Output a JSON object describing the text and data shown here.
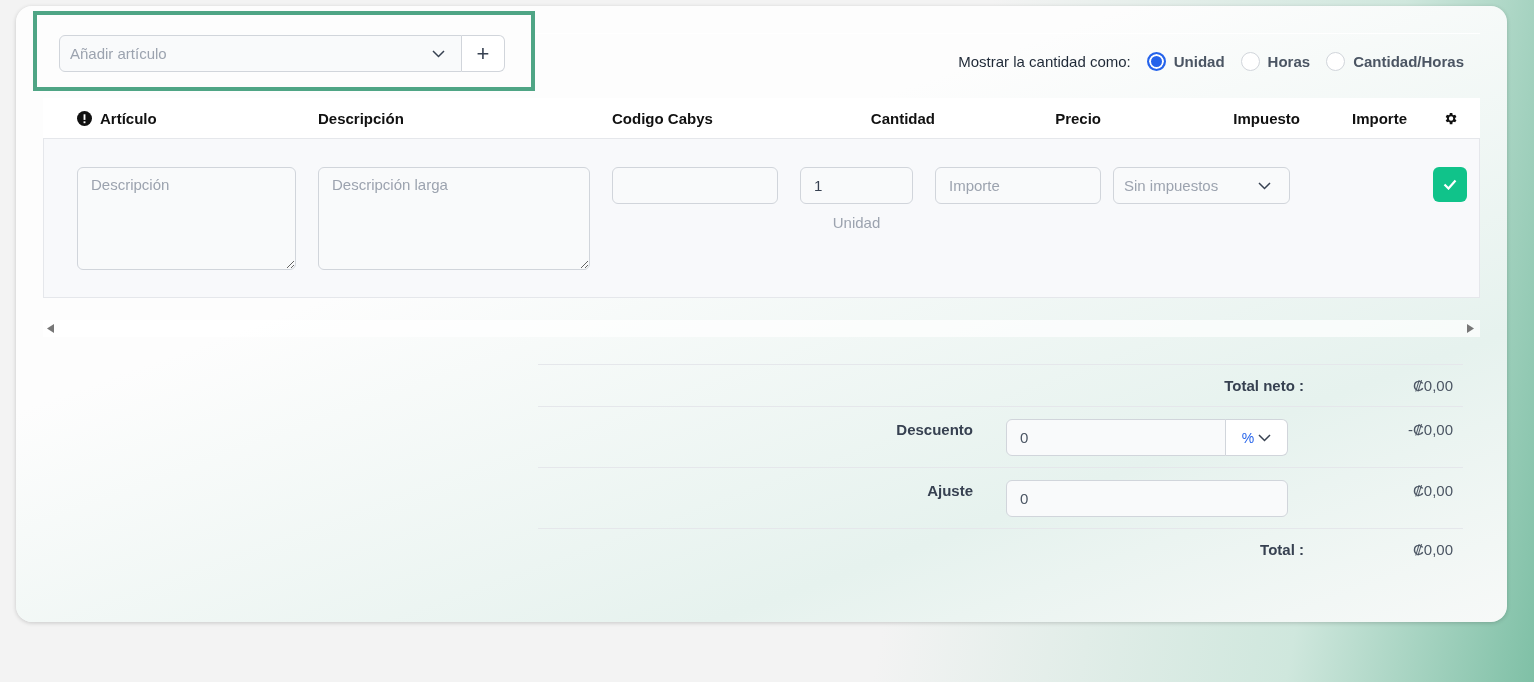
{
  "add_item": {
    "placeholder": "Añadir artículo",
    "add_button": "+"
  },
  "quantity_display": {
    "label": "Mostrar la cantidad como:",
    "options": [
      {
        "label": "Unidad",
        "selected": true
      },
      {
        "label": "Horas",
        "selected": false
      },
      {
        "label": "Cantidad/Horas",
        "selected": false
      }
    ]
  },
  "table": {
    "columns": [
      {
        "label": "Artículo",
        "kind": "alert"
      },
      {
        "label": "Descripción",
        "kind": "text"
      },
      {
        "label": "Codigo Cabys",
        "kind": "text"
      },
      {
        "label": "Cantidad",
        "kind": "text"
      },
      {
        "label": "Precio",
        "kind": "text"
      },
      {
        "label": "Impuesto",
        "kind": "text"
      },
      {
        "label": "Importe",
        "kind": "text"
      },
      {
        "kind": "settings"
      }
    ],
    "row": {
      "description": {
        "placeholder": "Descripción"
      },
      "long_description": {
        "placeholder": "Descripción larga"
      },
      "quantity": {
        "value": "1",
        "unit": "Unidad"
      },
      "price": {
        "placeholder": "Importe"
      },
      "tax": {
        "value": "Sin impuestos"
      }
    }
  },
  "totals": [
    {
      "kind": "sum",
      "label": "Total neto :",
      "value": "₡0,00"
    },
    {
      "kind": "discount",
      "label": "Descuento",
      "input": "0",
      "unit": "%",
      "value": "-₡0,00"
    },
    {
      "kind": "adjust",
      "label": "Ajuste",
      "input": "0",
      "value": "₡0,00"
    },
    {
      "kind": "sum",
      "label": "Total :",
      "value": "₡0,00"
    }
  ]
}
